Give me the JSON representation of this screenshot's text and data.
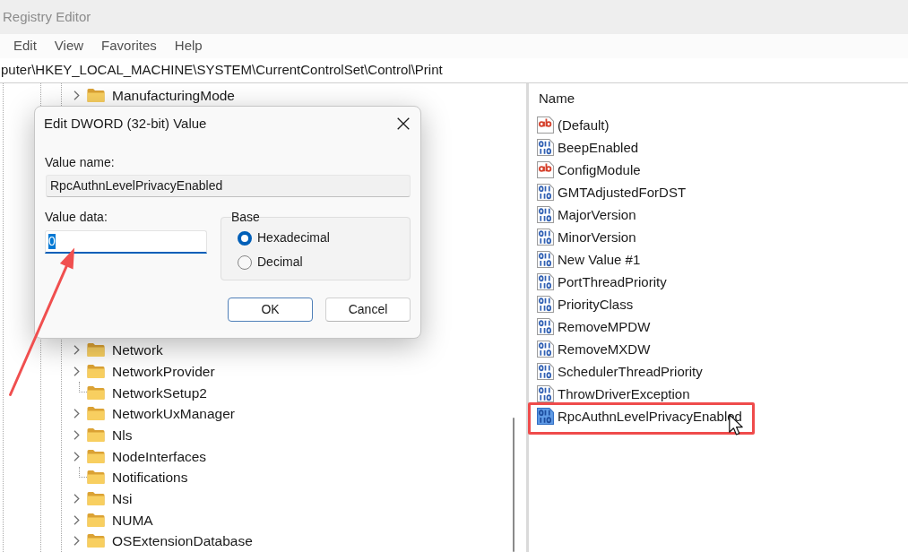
{
  "window": {
    "title": "Registry Editor"
  },
  "menu_bar": [
    "Edit",
    "View",
    "Favorites",
    "Help"
  ],
  "address_bar": {
    "path": "puter\\HKEY_LOCAL_MACHINE\\SYSTEM\\CurrentControlSet\\Control\\Print"
  },
  "tree": {
    "items_above_dialog": [
      {
        "label": "ManufacturingMode",
        "kind": "collapsed"
      }
    ],
    "items_below_dialog": [
      {
        "label": "Network",
        "kind": "collapsed"
      },
      {
        "label": "NetworkProvider",
        "kind": "collapsed"
      },
      {
        "label": "NetworkSetup2",
        "kind": "leaf"
      },
      {
        "label": "NetworkUxManager",
        "kind": "collapsed"
      },
      {
        "label": "Nls",
        "kind": "collapsed"
      },
      {
        "label": "NodeInterfaces",
        "kind": "collapsed"
      },
      {
        "label": "Notifications",
        "kind": "leaf"
      },
      {
        "label": "Nsi",
        "kind": "collapsed"
      },
      {
        "label": "NUMA",
        "kind": "collapsed"
      },
      {
        "label": "OSExtensionDatabase",
        "kind": "collapsed"
      }
    ]
  },
  "values_pane": {
    "column_header": "Name",
    "items": [
      {
        "name": "(Default)",
        "kind": "string",
        "selected": false,
        "highlighted": false
      },
      {
        "name": "BeepEnabled",
        "kind": "dword",
        "selected": false,
        "highlighted": false
      },
      {
        "name": "ConfigModule",
        "kind": "string",
        "selected": false,
        "highlighted": false
      },
      {
        "name": "GMTAdjustedForDST",
        "kind": "dword",
        "selected": false,
        "highlighted": false
      },
      {
        "name": "MajorVersion",
        "kind": "dword",
        "selected": false,
        "highlighted": false
      },
      {
        "name": "MinorVersion",
        "kind": "dword",
        "selected": false,
        "highlighted": false
      },
      {
        "name": "New Value #1",
        "kind": "dword",
        "selected": false,
        "highlighted": false
      },
      {
        "name": "PortThreadPriority",
        "kind": "dword",
        "selected": false,
        "highlighted": false
      },
      {
        "name": "PriorityClass",
        "kind": "dword",
        "selected": false,
        "highlighted": false
      },
      {
        "name": "RemoveMPDW",
        "kind": "dword",
        "selected": false,
        "highlighted": false
      },
      {
        "name": "RemoveMXDW",
        "kind": "dword",
        "selected": false,
        "highlighted": false
      },
      {
        "name": "SchedulerThreadPriority",
        "kind": "dword",
        "selected": false,
        "highlighted": false
      },
      {
        "name": "ThrowDriverException",
        "kind": "dword",
        "selected": false,
        "highlighted": false
      },
      {
        "name": "RpcAuthnLevelPrivacyEnabled",
        "kind": "dword",
        "selected": true,
        "highlighted": true
      }
    ]
  },
  "dialog": {
    "title": "Edit DWORD (32-bit) Value",
    "value_name": {
      "label": "Value name:",
      "value": "RpcAuthnLevelPrivacyEnabled"
    },
    "value_data": {
      "label": "Value data:",
      "value": "0",
      "text_selected": true
    },
    "base": {
      "label": "Base",
      "options": [
        {
          "label": "Hexadecimal",
          "selected": true
        },
        {
          "label": "Decimal",
          "selected": false
        }
      ]
    },
    "buttons": [
      {
        "label": "OK",
        "focused": true
      },
      {
        "label": "Cancel",
        "focused": false
      }
    ]
  }
}
